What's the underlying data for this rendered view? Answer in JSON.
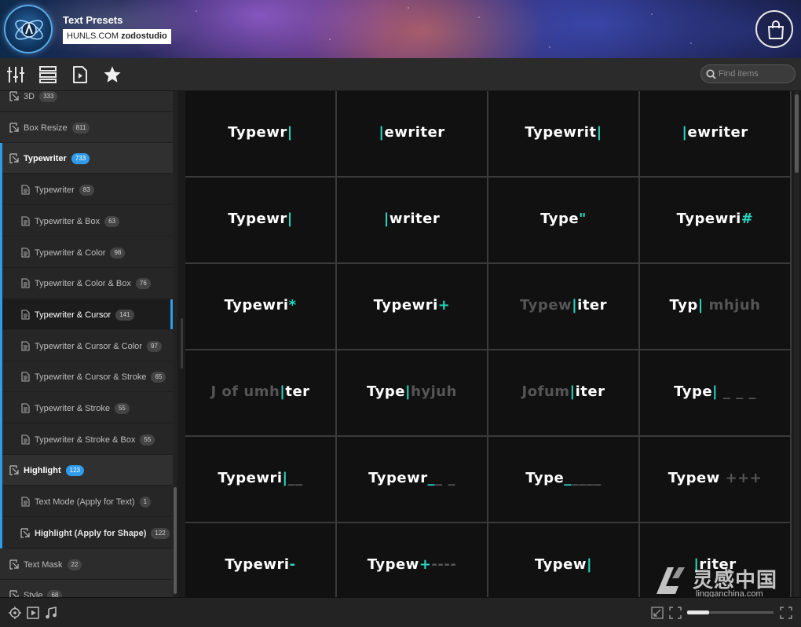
{
  "header": {
    "title": "Text Presets",
    "subtitle_normal": "HUNLS.COM",
    "subtitle_bold": "zodostudio"
  },
  "toolbar": {
    "icons": [
      "sliders-icon",
      "list-view-icon",
      "preview-file-icon",
      "star-icon"
    ],
    "search_placeholder": "Find items"
  },
  "sidebar": {
    "items": [
      {
        "label": "3D",
        "count": "333",
        "kind": "group"
      },
      {
        "label": "Box Resize",
        "count": "811",
        "kind": "group"
      },
      {
        "label": "Typewriter",
        "count": "733",
        "kind": "group-open"
      },
      {
        "label": "Typewriter",
        "count": "83",
        "kind": "child"
      },
      {
        "label": "Typewriter & Box",
        "count": "63",
        "kind": "child"
      },
      {
        "label": "Typewriter & Color",
        "count": "98",
        "kind": "child"
      },
      {
        "label": "Typewriter & Color & Box",
        "count": "76",
        "kind": "child"
      },
      {
        "label": "Typewriter & Cursor",
        "count": "141",
        "kind": "child-selected"
      },
      {
        "label": "Typewriter & Cursor & Color",
        "count": "97",
        "kind": "child"
      },
      {
        "label": "Typewriter & Cursor & Stroke",
        "count": "65",
        "kind": "child"
      },
      {
        "label": "Typewriter & Stroke",
        "count": "55",
        "kind": "child"
      },
      {
        "label": "Typewriter & Stroke & Box",
        "count": "55",
        "kind": "child"
      },
      {
        "label": "Highlight",
        "count": "123",
        "kind": "group-open"
      },
      {
        "label": "Text Mode (Apply for Text)",
        "count": "1",
        "kind": "child"
      },
      {
        "label": "Highlight (Apply for Shape)",
        "count": "122",
        "kind": "child-bold"
      },
      {
        "label": "Text Mask",
        "count": "22",
        "kind": "group"
      },
      {
        "label": "Style",
        "count": "68",
        "kind": "group"
      }
    ]
  },
  "grid": {
    "cells": [
      [
        {
          "t": "Typewr",
          "c": "|",
          "d": ""
        },
        {
          "t": "ewriter",
          "c": "|",
          "d": "",
          "pre": true
        },
        {
          "t": "Typewrit",
          "c": "|",
          "d": ""
        },
        {
          "t": "ewriter",
          "c": "|",
          "d": "",
          "pre": true
        }
      ],
      [
        {
          "t": "Typewr",
          "c": "|",
          "d": ""
        },
        {
          "t": "writer",
          "c": "|",
          "d": "",
          "pre": true
        },
        {
          "t": "Type",
          "c": "\"",
          "d": ""
        },
        {
          "t": "Typewri",
          "c": "#",
          "d": ""
        }
      ],
      [
        {
          "t": "Typewri",
          "c": "*",
          "d": ""
        },
        {
          "t": "Typewri",
          "c": "+",
          "d": ""
        },
        {
          "d0": "Typew",
          "c": "|",
          "t": "iter",
          "mid": true
        },
        {
          "t": "Typ",
          "c": "|",
          "d": " mhjuh"
        }
      ],
      [
        {
          "d0": "J of umh",
          "c": "|",
          "t": "ter",
          "mid": true
        },
        {
          "t": "Type",
          "c": "|",
          "d": "hyjuh"
        },
        {
          "d0": "Jofum",
          "c": "|",
          "t": "iter",
          "mid": true
        },
        {
          "t": "Type",
          "c": "|",
          "d": " _ _ _"
        }
      ],
      [
        {
          "t": "Typewri",
          "c": "|",
          "d": "__"
        },
        {
          "t": "Typewr",
          "c": "_",
          "d": "_ _"
        },
        {
          "t": "Type",
          "c": "_",
          "d": "____"
        },
        {
          "t": "Typew",
          "c": "",
          "d": " +++"
        }
      ],
      [
        {
          "t": "Typewri",
          "c": "-",
          "d": ""
        },
        {
          "t": "Typew",
          "c": "+",
          "d": "----"
        },
        {
          "t": "Typew",
          "c": "|",
          "d": ""
        },
        {
          "t": "riter",
          "c": "|",
          "d": "",
          "pre": true
        }
      ]
    ]
  },
  "watermark": {
    "cn": "灵感中国",
    "en": "lingganchina.com"
  },
  "bottombar": {
    "zoom_level": 0.25
  },
  "colors": {
    "accent": "#2f9bea",
    "cursor": "#27d8c0"
  }
}
